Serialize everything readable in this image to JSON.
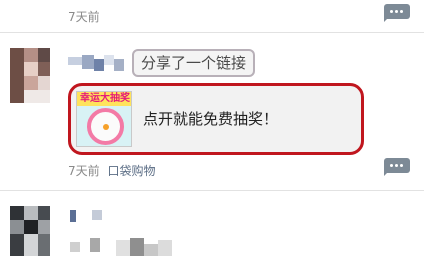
{
  "top_item": {
    "time": "7天前",
    "comment_icon": "comment-icon"
  },
  "post": {
    "action_text": "分享了一个链接",
    "link": {
      "thumbnail_banner": "幸运大抽奖",
      "title": "点开就能免费抽奖！"
    },
    "time": "7天前",
    "source": "口袋购物",
    "comment_icon": "comment-icon"
  },
  "colors": {
    "highlight_red": "#c0161e",
    "meta_grey": "#8a8a8a",
    "source_blue": "#5b6d85",
    "comment_icon": "#7d8a96"
  }
}
